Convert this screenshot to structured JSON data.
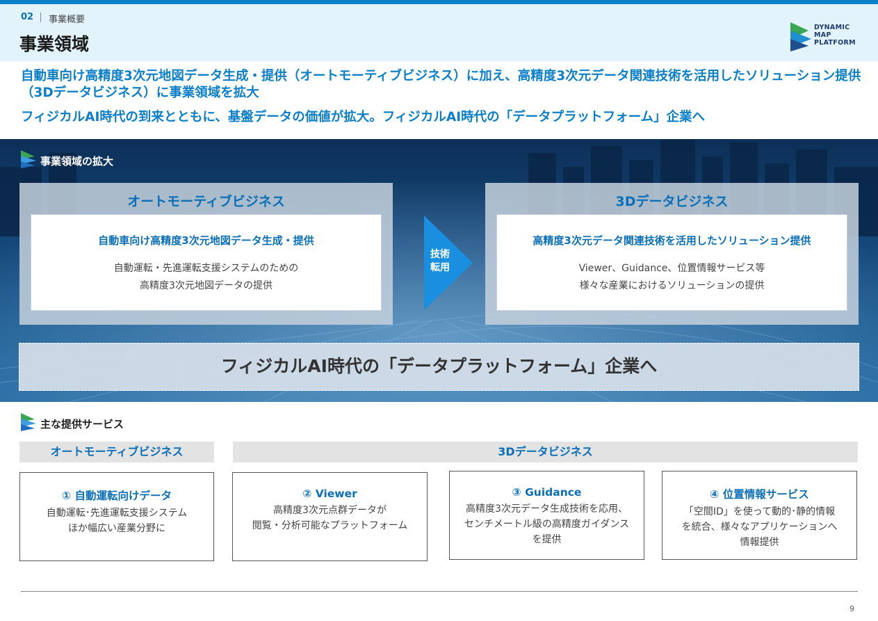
{
  "header": {
    "section_number": "02",
    "section_name": "事業概要",
    "title": "事業領域"
  },
  "logo": {
    "lines": [
      "DYNAMIC",
      "MAP",
      "PLATFORM"
    ]
  },
  "lead": {
    "line1": "自動車向け高精度3次元地図データ生成・提供（オートモーティブビジネス）に加え、高精度3次元データ関連技術を活用したソリューション提供（3Dデータビジネス）に事業領域を拡大",
    "line2": "フィジカルAI時代の到来とともに、基盤データの価値が拡大。フィジカルAI時代の「データプラットフォーム」企業へ"
  },
  "expansion": {
    "heading": "事業領域の拡大",
    "left": {
      "title": "オートモーティブビジネス",
      "inner_heading": "自動車向け高精度3次元地図データ生成・提供",
      "inner_line1": "自動運転・先進運転支援システムのための",
      "inner_line2": "高精度3次元地図データの提供"
    },
    "arrow": {
      "line1": "技術",
      "line2": "転用"
    },
    "right": {
      "title": "3Dデータビジネス",
      "inner_heading": "高精度3次元データ関連技術を活用したソリューション提供",
      "inner_line1": "Viewer、Guidance、位置情報サービス等",
      "inner_line2": "様々な産業におけるソリューションの提供"
    },
    "platform": "フィジカルAI時代の「データプラットフォーム」企業へ"
  },
  "services": {
    "heading": "主な提供サービス",
    "category_left": "オートモーティブビジネス",
    "category_right": "3Dデータビジネス",
    "cards": [
      {
        "title": "① 自動運転向けデータ",
        "lines": [
          "自動運転･先進運転支援システム",
          "ほか幅広い産業分野に"
        ]
      },
      {
        "title": "② Viewer",
        "lines": [
          "高精度3次元点群データが",
          "閲覧・分析可能なプラットフォーム"
        ]
      },
      {
        "title": "③ Guidance",
        "lines": [
          "高精度3次元データ生成技術を応用、",
          "センチメートル級の高精度ガイダンス",
          "を提供"
        ]
      },
      {
        "title": "④ 位置情報サービス",
        "lines": [
          "「空間ID」を使って動的･静的情報",
          "を統合、様々なアプリケーションへ",
          "情報提供"
        ]
      }
    ]
  },
  "footer": {
    "page_number": "9"
  },
  "colors": {
    "accent": "#0b7fc9",
    "header_bg": "#e2f3fb",
    "band_dark": "#0c2f57",
    "logo_green": "#3aa655",
    "logo_blue": "#1e4e8c"
  }
}
